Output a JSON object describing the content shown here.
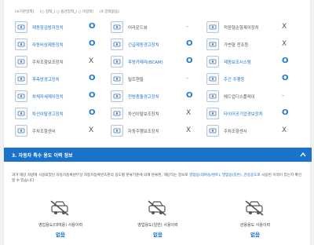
{
  "legend": [
    "(⊙기본장착)",
    "(○ 장착_/ ○ 옵션장착_/ ○ 미장착)",
    "(X 장착없음)"
  ],
  "features": [
    [
      {
        "label": "제동잠김방지장치",
        "value": "O",
        "icon": "abs-icon",
        "label_color": "blue"
      },
      {
        "label": "어라운드뷰",
        "value": "-",
        "icon": "around-view-icon",
        "label_color": "grey"
      },
      {
        "label": "적응형순항제어장치",
        "value": "X",
        "icon": "cruise-icon",
        "label_color": "grey"
      }
    ],
    [
      {
        "label": "자동비상제동장치",
        "value": "O",
        "icon": "emergency-brake-icon",
        "label_color": "blue"
      },
      {
        "label": "긴급제동경고장치",
        "value": "O",
        "icon": "brake-warning-icon",
        "label_color": "blue"
      },
      {
        "label": "가변형 전조등",
        "value": "X",
        "icon": "headlight-icon",
        "label_color": "grey"
      }
    ],
    [
      {
        "label": "주차조향보조장치",
        "value": "X",
        "icon": "parking-assist-icon",
        "label_color": "grey"
      },
      {
        "label": "후방카메라(BCAM)",
        "value": "O",
        "icon": "rear-camera-icon",
        "label_color": "blue"
      },
      {
        "label": "제동보조시스템",
        "value": "O",
        "icon": "brake-assist-icon",
        "label_color": "blue"
      }
    ],
    [
      {
        "label": "후측방경고장치",
        "value": "O",
        "icon": "blind-spot-icon",
        "label_color": "blue"
      },
      {
        "label": "틸트핸들",
        "value": "-",
        "icon": "tilt-steering-icon",
        "label_color": "grey"
      },
      {
        "label": "주간 주행등",
        "value": "O",
        "icon": "daytime-light-icon",
        "label_color": "blue"
      }
    ],
    [
      {
        "label": "차체자세제어장치",
        "value": "O",
        "icon": "stability-control-icon",
        "label_color": "blue"
      },
      {
        "label": "전방충돌경고장치",
        "value": "O",
        "icon": "collision-warning-icon",
        "label_color": "blue"
      },
      {
        "label": "헤드업디스플레이",
        "value": "-",
        "icon": "hud-icon",
        "label_color": "grey"
      }
    ],
    [
      {
        "label": "차선이탈경고장치",
        "value": "O",
        "icon": "lane-departure-icon",
        "label_color": "blue"
      },
      {
        "label": "차선이탈보조장치",
        "value": "X",
        "icon": "lane-keep-icon",
        "label_color": "grey"
      },
      {
        "label": "타이어공기압경보장치",
        "value": "O",
        "icon": "tire-pressure-icon",
        "label_color": "blue"
      }
    ],
    [
      {
        "label": "주차조향센서",
        "value": "X",
        "icon": "parking-sensor-icon",
        "label_color": "grey"
      },
      {
        "label": "자동주행보조장치",
        "value": "X",
        "icon": "driving-assist-icon",
        "label_color": "grey"
      },
      {
        "label": "주차조향센서",
        "value": "X",
        "icon": "sensor-icon",
        "label_color": "grey"
      }
    ]
  ],
  "section": {
    "title": "3. 자동차 특수 용도 이력 정보"
  },
  "description": {
    "text": "과거 해당 차량에 사용되었던 자동차등록원부상 자동차등록번호판의 용도별 분류기준에 의해 분류된, 해당하는 정보로",
    "highlight": "영업용(대여용/렌트), 영업용(일반), 관용용도로",
    "tail": "사용된 이력이 있는지 확인할 수 있습니다."
  },
  "usage": [
    {
      "title": "영업용도(대여용) 사용이력",
      "value": "없음",
      "icon": "rental-car-crossed-icon"
    },
    {
      "title": "영업용도(일반) 사용이력",
      "value": "없음",
      "icon": "commercial-car-crossed-icon"
    },
    {
      "title": "관용용도 사용이력",
      "value": "없음",
      "icon": "government-car-crossed-icon"
    }
  ],
  "colors": {
    "accent": "#1a73c8",
    "yes": "#1f78d1",
    "section_bg": "#1a73c8"
  }
}
